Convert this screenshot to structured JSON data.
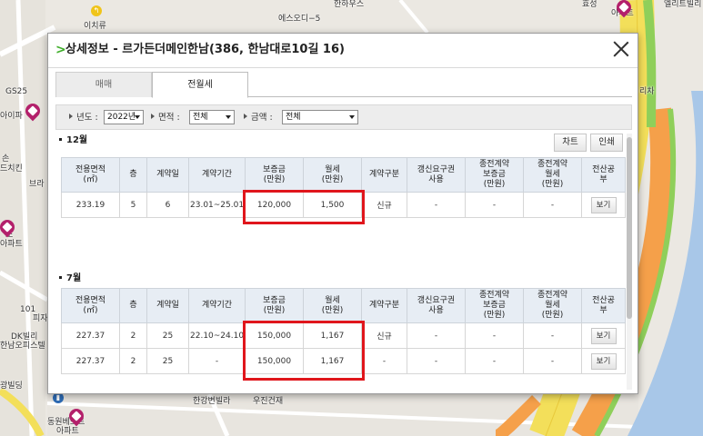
{
  "map": {
    "labels": {
      "ichihu": "이치류",
      "esu_odi": "에스오디−5",
      "hanhouse": "한하우스",
      "hyoseong": "효성",
      "apt_top": "아파트",
      "elite": "엘리트빌리",
      "gs25": "GS25",
      "aipak": "아이파",
      "deuchikin": "드치킨",
      "seon": "손",
      "bra": "브라",
      "sso": "소",
      "apat_left": "아파트",
      "num_101": "101",
      "pija": "피자",
      "dk": "DK빌리",
      "hannam_office": "한남오피스텔",
      "gwang": "광빌딩",
      "dongwon": "동원베스트",
      "apt_bottom": "아파트",
      "hangang_villa": "한강변빌라",
      "ujin": "우진건재",
      "licha": "리차"
    }
  },
  "dialog": {
    "title": "상세정보 - 르가든더메인한남(386, 한남대로10길 16)",
    "arrow": ">",
    "tabs": {
      "trade": "매매",
      "rent": "전월세"
    },
    "filters": {
      "year_label": "년도 :",
      "year_value": "2022년",
      "area_label": "면적 :",
      "area_value": "전체",
      "amount_label": "금액 :",
      "amount_value": "전체"
    },
    "buttons": {
      "chart": "차트",
      "print": "인쇄"
    },
    "columns": [
      "전용면적\n(㎡)",
      "층",
      "계약일",
      "계약기간",
      "보증금\n(만원)",
      "월세\n(만원)",
      "계약구분",
      "갱신요구권\n사용",
      "종전계약\n보증금\n(만원)",
      "종전계약\n월세\n(만원)",
      "전산공\n부"
    ],
    "sections": [
      {
        "title": "12월",
        "rows": [
          {
            "area": "233.19",
            "floor": "5",
            "day": "6",
            "period": "23.01~25.01",
            "deposit": "120,000",
            "rent": "1,500",
            "type": "신규",
            "renewal": "-",
            "prev_deposit": "-",
            "prev_rent": "-",
            "view": "보기"
          }
        ]
      },
      {
        "title": "7월",
        "rows": [
          {
            "area": "227.37",
            "floor": "2",
            "day": "25",
            "period": "22.10~24.10",
            "deposit": "150,000",
            "rent": "1,167",
            "type": "신규",
            "renewal": "-",
            "prev_deposit": "-",
            "prev_rent": "-",
            "view": "보기"
          },
          {
            "area": "227.37",
            "floor": "2",
            "day": "25",
            "period": "-",
            "deposit": "150,000",
            "rent": "1,167",
            "type": "-",
            "renewal": "-",
            "prev_deposit": "-",
            "prev_rent": "-",
            "view": "보기"
          }
        ]
      }
    ]
  },
  "colors": {
    "highlight": "#e0161c",
    "header_bg": "#e7edf4",
    "accent_green": "#3fae2a",
    "pin": "#b3206b"
  }
}
